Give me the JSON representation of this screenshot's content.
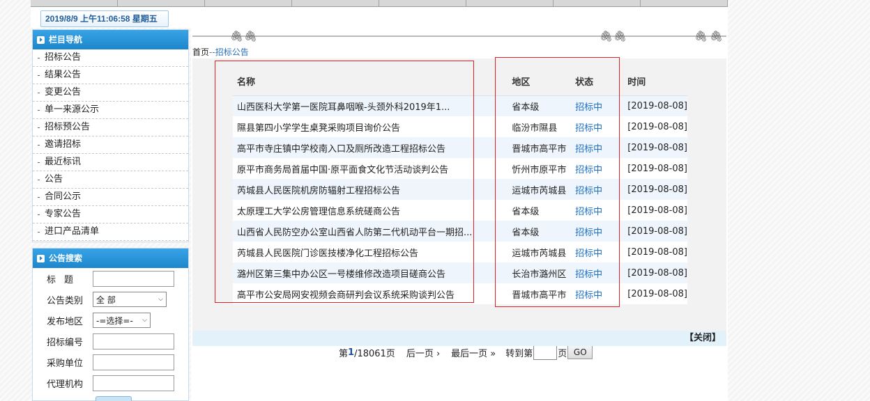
{
  "header": {
    "datetime": "2019/8/9 上午11:06:58 星期五"
  },
  "sidebar": {
    "title": "栏目导航",
    "items": [
      {
        "label": "招标公告"
      },
      {
        "label": "结果公告"
      },
      {
        "label": "变更公告"
      },
      {
        "label": "单一来源公示"
      },
      {
        "label": "招标预公告"
      },
      {
        "label": "邀请招标"
      },
      {
        "label": "最近标讯"
      },
      {
        "label": "公告"
      },
      {
        "label": "合同公示"
      },
      {
        "label": "专家公告"
      },
      {
        "label": "进口产品清单"
      }
    ]
  },
  "search": {
    "title": "公告搜索",
    "title_label": "标题",
    "category_label": "公告类别",
    "category_value": "全 部",
    "region_label": "发布地区",
    "region_value": "-=选择=-",
    "bid_no_label": "招标编号",
    "purchaser_label": "采购单位",
    "agency_label": "代理机构"
  },
  "breadcrumb": {
    "home": "首页",
    "sep": "--",
    "current": "招标公告"
  },
  "table": {
    "headers": {
      "name": "名称",
      "region": "地区",
      "status": "状态",
      "time": "时间"
    },
    "rows": [
      {
        "name": "山西医科大学第一医院耳鼻咽喉-头颈外科2019年1...",
        "region": "省本级",
        "status": "招标中",
        "time": "[2019-08-08]"
      },
      {
        "name": "隰县第四小学学生桌凳采购项目询价公告",
        "region": "临汾市隰县",
        "status": "招标中",
        "time": "[2019-08-08]"
      },
      {
        "name": "高平市寺庄镇中学校南入口及厕所改造工程招标公告",
        "region": "晋城市高平市",
        "status": "招标中",
        "time": "[2019-08-08]"
      },
      {
        "name": "原平市商务局首届中国·原平面食文化节活动谈判公告",
        "region": "忻州市原平市",
        "status": "招标中",
        "time": "[2019-08-08]"
      },
      {
        "name": "芮城县人民医院机房防辐射工程招标公告",
        "region": "运城市芮城县",
        "status": "招标中",
        "time": "[2019-08-08]"
      },
      {
        "name": "太原理工大学公房管理信息系统磋商公告",
        "region": "省本级",
        "status": "招标中",
        "time": "[2019-08-08]"
      },
      {
        "name": "山西省人民防空办公室山西省人防第二代机动平台一期招...",
        "region": "省本级",
        "status": "招标中",
        "time": "[2019-08-08]"
      },
      {
        "name": "芮城县人民医院门诊医技楼净化工程招标公告",
        "region": "运城市芮城县",
        "status": "招标中",
        "time": "[2019-08-08]"
      },
      {
        "name": "潞州区第三集中办公区一号楼维修改造项目磋商公告",
        "region": "长治市潞州区",
        "status": "招标中",
        "time": "[2019-08-08]"
      },
      {
        "name": "高平市公安局网安视频会商研判会议系统采购谈判公告",
        "region": "晋城市高平市",
        "status": "招标中",
        "time": "[2019-08-08]"
      }
    ]
  },
  "pager": {
    "prefix": "第",
    "current": "1",
    "total": "/18061页",
    "next": "后一页 ›",
    "last": "最后一页 »",
    "goto_prefix": "转到第",
    "goto_suffix": "页",
    "go": "GO"
  },
  "close_label": "【关闭】"
}
